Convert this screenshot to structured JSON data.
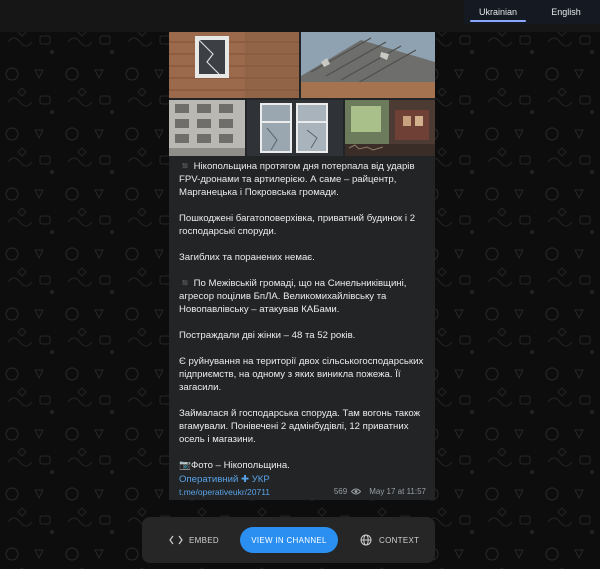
{
  "lang": {
    "ukrainian": "Ukrainian",
    "english": "English"
  },
  "post": {
    "paragraphs": [
      "◾️ Нікопольщина протягом дня потерпала від ударів FPV-дронами та артилерією. А саме – райцентр, Марганецька і Покровська громади.",
      "Пошкоджені багатоповерхівка, приватний будинок і 2 господарські споруди.",
      "Загиблих та поранених немає.",
      "◾️ По Межівській громаді, що на Синельниківщині, агресор поцілив БпЛА. Великомихайлівську та Новопавлівську – атакував КАБами.",
      "Постраждали дві жінки – 48 та 52 років.",
      "Є руйнування на території двох сільськогосподарських підприємств, на одному з яких виникла пожежа. Її загасили.",
      "Займалася й господарська споруда. Там вогонь також вгамували. Понівечені 2 адмінбудівлі, 12 приватних осель і магазини.",
      "📷Фото – Нікопольщина."
    ],
    "author": "Оперативний ✚ УКР",
    "link": "t.me/operativeukr/20711",
    "views": "569",
    "date": "May 17 at 11:57"
  },
  "actions": {
    "embed": "EMBED",
    "view": "VIEW IN CHANNEL",
    "context": "CONTEXT"
  },
  "colors": {
    "accent": "#2a8ff0",
    "link": "#5aa3ea",
    "post_bg": "#222425",
    "page_bg": "#0d0d0d"
  }
}
